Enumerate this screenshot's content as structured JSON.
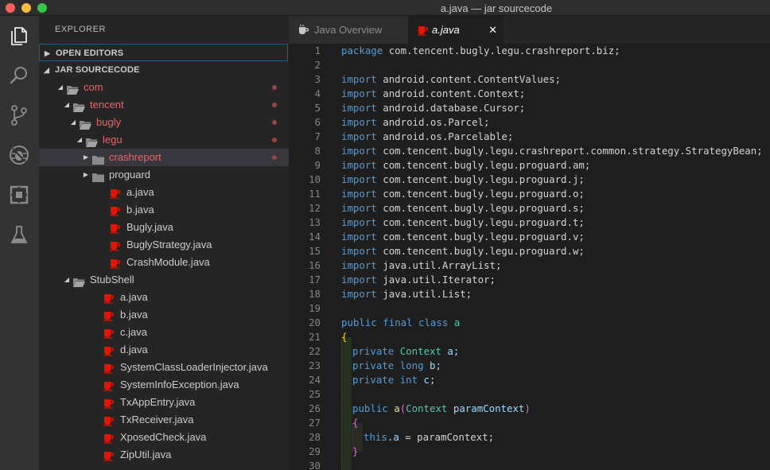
{
  "window": {
    "title": "a.java — jar sourcecode"
  },
  "activity_bar": {
    "items": [
      {
        "name": "explorer-icon"
      },
      {
        "name": "search-icon"
      },
      {
        "name": "source-control-icon"
      },
      {
        "name": "debug-icon"
      },
      {
        "name": "extensions-icon"
      },
      {
        "name": "flask-icon"
      }
    ]
  },
  "sidebar": {
    "title": "EXPLORER",
    "open_editors_label": "OPEN EDITORS",
    "project_label": "JAR SOURCECODE",
    "tree": [
      {
        "label": "com",
        "kind": "folder-open",
        "depth": 0,
        "modified": true
      },
      {
        "label": "tencent",
        "kind": "folder-open",
        "depth": 1,
        "modified": true
      },
      {
        "label": "bugly",
        "kind": "folder-open",
        "depth": 2,
        "modified": true
      },
      {
        "label": "legu",
        "kind": "folder-open",
        "depth": 3,
        "modified": true
      },
      {
        "label": "crashreport",
        "kind": "folder-closed",
        "depth": 4,
        "modified": true,
        "selected": true
      },
      {
        "label": "proguard",
        "kind": "folder-closed",
        "depth": 4,
        "modified": false
      },
      {
        "label": "a.java",
        "kind": "java",
        "depth": 4
      },
      {
        "label": "b.java",
        "kind": "java",
        "depth": 4
      },
      {
        "label": "Bugly.java",
        "kind": "java",
        "depth": 4
      },
      {
        "label": "BuglyStrategy.java",
        "kind": "java",
        "depth": 4
      },
      {
        "label": "CrashModule.java",
        "kind": "java",
        "depth": 4
      },
      {
        "label": "StubShell",
        "kind": "folder-open",
        "depth": 1,
        "modified": false
      },
      {
        "label": "a.java",
        "kind": "java",
        "depth": 3
      },
      {
        "label": "b.java",
        "kind": "java",
        "depth": 3
      },
      {
        "label": "c.java",
        "kind": "java",
        "depth": 3
      },
      {
        "label": "d.java",
        "kind": "java",
        "depth": 3
      },
      {
        "label": "SystemClassLoaderInjector.java",
        "kind": "java",
        "depth": 3
      },
      {
        "label": "SystemInfoException.java",
        "kind": "java",
        "depth": 3
      },
      {
        "label": "TxAppEntry.java",
        "kind": "java",
        "depth": 3
      },
      {
        "label": "TxReceiver.java",
        "kind": "java",
        "depth": 3
      },
      {
        "label": "XposedCheck.java",
        "kind": "java",
        "depth": 3
      },
      {
        "label": "ZipUtil.java",
        "kind": "java",
        "depth": 3
      }
    ]
  },
  "tabs": [
    {
      "label": "Java Overview",
      "active": false
    },
    {
      "label": "a.java",
      "active": true,
      "close": "✕"
    }
  ],
  "editor": {
    "lines": [
      {
        "n": "1",
        "t": [
          [
            "kw",
            "package"
          ],
          [
            "",
            "com.tencent.bugly.legu.crashreport.biz;"
          ]
        ]
      },
      {
        "n": "2",
        "t": []
      },
      {
        "n": "3",
        "t": [
          [
            "kw",
            "import"
          ],
          [
            "",
            "android.content.ContentValues;"
          ]
        ]
      },
      {
        "n": "4",
        "t": [
          [
            "kw",
            "import"
          ],
          [
            "",
            "android.content.Context;"
          ]
        ]
      },
      {
        "n": "5",
        "t": [
          [
            "kw",
            "import"
          ],
          [
            "",
            "android.database.Cursor;"
          ]
        ]
      },
      {
        "n": "6",
        "t": [
          [
            "kw",
            "import"
          ],
          [
            "",
            "android.os.Parcel;"
          ]
        ]
      },
      {
        "n": "7",
        "t": [
          [
            "kw",
            "import"
          ],
          [
            "",
            "android.os.Parcelable;"
          ]
        ]
      },
      {
        "n": "8",
        "t": [
          [
            "kw",
            "import"
          ],
          [
            "",
            "com.tencent.bugly.legu.crashreport.common.strategy.StrategyBean;"
          ]
        ]
      },
      {
        "n": "9",
        "t": [
          [
            "kw",
            "import"
          ],
          [
            "",
            "com.tencent.bugly.legu.proguard.am;"
          ]
        ]
      },
      {
        "n": "10",
        "t": [
          [
            "kw",
            "import"
          ],
          [
            "",
            "com.tencent.bugly.legu.proguard.j;"
          ]
        ]
      },
      {
        "n": "11",
        "t": [
          [
            "kw",
            "import"
          ],
          [
            "",
            "com.tencent.bugly.legu.proguard.o;"
          ]
        ]
      },
      {
        "n": "12",
        "t": [
          [
            "kw",
            "import"
          ],
          [
            "",
            "com.tencent.bugly.legu.proguard.s;"
          ]
        ]
      },
      {
        "n": "13",
        "t": [
          [
            "kw",
            "import"
          ],
          [
            "",
            "com.tencent.bugly.legu.proguard.t;"
          ]
        ]
      },
      {
        "n": "14",
        "t": [
          [
            "kw",
            "import"
          ],
          [
            "",
            "com.tencent.bugly.legu.proguard.v;"
          ]
        ]
      },
      {
        "n": "15",
        "t": [
          [
            "kw",
            "import"
          ],
          [
            "",
            "com.tencent.bugly.legu.proguard.w;"
          ]
        ]
      },
      {
        "n": "16",
        "t": [
          [
            "kw",
            "import"
          ],
          [
            "",
            "java.util.ArrayList;"
          ]
        ]
      },
      {
        "n": "17",
        "t": [
          [
            "kw",
            "import"
          ],
          [
            "",
            "java.util.Iterator;"
          ]
        ]
      },
      {
        "n": "18",
        "t": [
          [
            "kw",
            "import"
          ],
          [
            "",
            "java.util.List;"
          ]
        ]
      },
      {
        "n": "19",
        "t": []
      },
      {
        "n": "20",
        "t": [
          [
            "kw",
            "public"
          ],
          [
            "kw",
            "final"
          ],
          [
            "kw",
            "class"
          ],
          [
            "ty",
            "a"
          ]
        ]
      },
      {
        "n": "21",
        "t": [
          [
            "br",
            "{"
          ]
        ]
      },
      {
        "n": "22",
        "t": [
          [
            "kw",
            "private"
          ],
          [
            "ty",
            "Context"
          ],
          [
            "pm",
            "a;"
          ]
        ]
      },
      {
        "n": "23",
        "t": [
          [
            "kw",
            "private"
          ],
          [
            "kw",
            "long"
          ],
          [
            "pm",
            "b;"
          ]
        ]
      },
      {
        "n": "24",
        "t": [
          [
            "kw",
            "private"
          ],
          [
            "kw",
            "int"
          ],
          [
            "pm",
            "c;"
          ]
        ]
      },
      {
        "n": "25",
        "t": []
      },
      {
        "n": "26",
        "t": [
          [
            "kw",
            "public"
          ],
          [
            "fn",
            "a"
          ],
          [
            "br2",
            "("
          ],
          [
            "ty",
            "Context"
          ],
          [
            "pm",
            "paramContext"
          ],
          [
            "br2",
            ")"
          ]
        ]
      },
      {
        "n": "27",
        "t": [
          [
            "br2",
            "{"
          ]
        ]
      },
      {
        "n": "28",
        "t": [
          [
            "kw",
            "this"
          ],
          [
            "",
            "."
          ],
          [
            "pm",
            "a"
          ],
          [
            "",
            " = paramContext;"
          ]
        ]
      },
      {
        "n": "29",
        "t": [
          [
            "br2",
            "}"
          ]
        ]
      },
      {
        "n": "30",
        "t": []
      }
    ]
  }
}
